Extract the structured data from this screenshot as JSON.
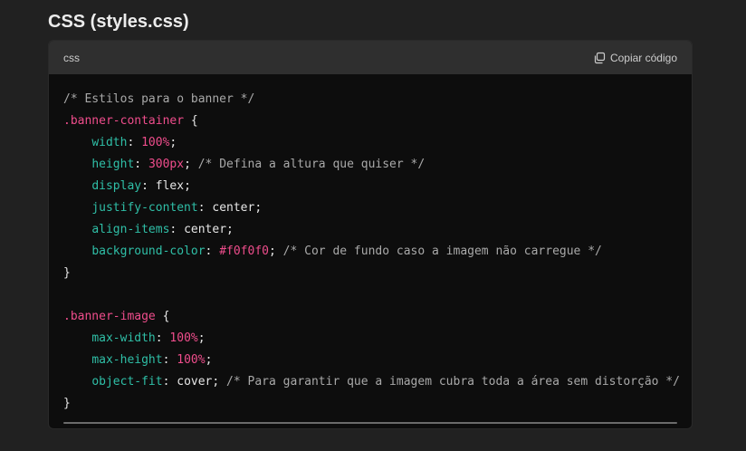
{
  "heading": "CSS (styles.css)",
  "code_block": {
    "language": "css",
    "copy_label": "Copiar código",
    "copy_icon": "copy-icon",
    "lines": [
      [
        {
          "t": "comment",
          "v": "/* Estilos para o banner */"
        }
      ],
      [
        {
          "t": "selector",
          "v": ".banner-container"
        },
        {
          "t": "punct",
          "v": " {"
        }
      ],
      [
        {
          "t": "punct",
          "v": "    "
        },
        {
          "t": "prop",
          "v": "width"
        },
        {
          "t": "punct",
          "v": ": "
        },
        {
          "t": "num",
          "v": "100%"
        },
        {
          "t": "punct",
          "v": ";"
        }
      ],
      [
        {
          "t": "punct",
          "v": "    "
        },
        {
          "t": "prop",
          "v": "height"
        },
        {
          "t": "punct",
          "v": ": "
        },
        {
          "t": "num",
          "v": "300px"
        },
        {
          "t": "punct",
          "v": "; "
        },
        {
          "t": "comment",
          "v": "/* Defina a altura que quiser */"
        }
      ],
      [
        {
          "t": "punct",
          "v": "    "
        },
        {
          "t": "prop",
          "v": "display"
        },
        {
          "t": "punct",
          "v": ": "
        },
        {
          "t": "value",
          "v": "flex"
        },
        {
          "t": "punct",
          "v": ";"
        }
      ],
      [
        {
          "t": "punct",
          "v": "    "
        },
        {
          "t": "prop",
          "v": "justify-content"
        },
        {
          "t": "punct",
          "v": ": "
        },
        {
          "t": "value",
          "v": "center"
        },
        {
          "t": "punct",
          "v": ";"
        }
      ],
      [
        {
          "t": "punct",
          "v": "    "
        },
        {
          "t": "prop",
          "v": "align-items"
        },
        {
          "t": "punct",
          "v": ": "
        },
        {
          "t": "value",
          "v": "center"
        },
        {
          "t": "punct",
          "v": ";"
        }
      ],
      [
        {
          "t": "punct",
          "v": "    "
        },
        {
          "t": "prop",
          "v": "background-color"
        },
        {
          "t": "punct",
          "v": ": "
        },
        {
          "t": "hex",
          "v": "#f0f0f0"
        },
        {
          "t": "punct",
          "v": "; "
        },
        {
          "t": "comment",
          "v": "/* Cor de fundo caso a imagem não carregue */"
        }
      ],
      [
        {
          "t": "punct",
          "v": "}"
        }
      ],
      [],
      [
        {
          "t": "selector",
          "v": ".banner-image"
        },
        {
          "t": "punct",
          "v": " {"
        }
      ],
      [
        {
          "t": "punct",
          "v": "    "
        },
        {
          "t": "prop",
          "v": "max-width"
        },
        {
          "t": "punct",
          "v": ": "
        },
        {
          "t": "num",
          "v": "100%"
        },
        {
          "t": "punct",
          "v": ";"
        }
      ],
      [
        {
          "t": "punct",
          "v": "    "
        },
        {
          "t": "prop",
          "v": "max-height"
        },
        {
          "t": "punct",
          "v": ": "
        },
        {
          "t": "num",
          "v": "100%"
        },
        {
          "t": "punct",
          "v": ";"
        }
      ],
      [
        {
          "t": "punct",
          "v": "    "
        },
        {
          "t": "prop",
          "v": "object-fit"
        },
        {
          "t": "punct",
          "v": ": "
        },
        {
          "t": "value",
          "v": "cover"
        },
        {
          "t": "punct",
          "v": "; "
        },
        {
          "t": "comment",
          "v": "/* Para garantir que a imagem cubra toda a área sem distorção */"
        }
      ],
      [
        {
          "t": "punct",
          "v": "}"
        }
      ]
    ]
  },
  "colors": {
    "page_bg": "#212121",
    "code_bg": "#0d0d0d",
    "header_bg": "#2f2f2f",
    "selector": "#ef4d8c",
    "property": "#2fbfa7",
    "number": "#ef4d8c",
    "comment": "#a9a9a9"
  }
}
